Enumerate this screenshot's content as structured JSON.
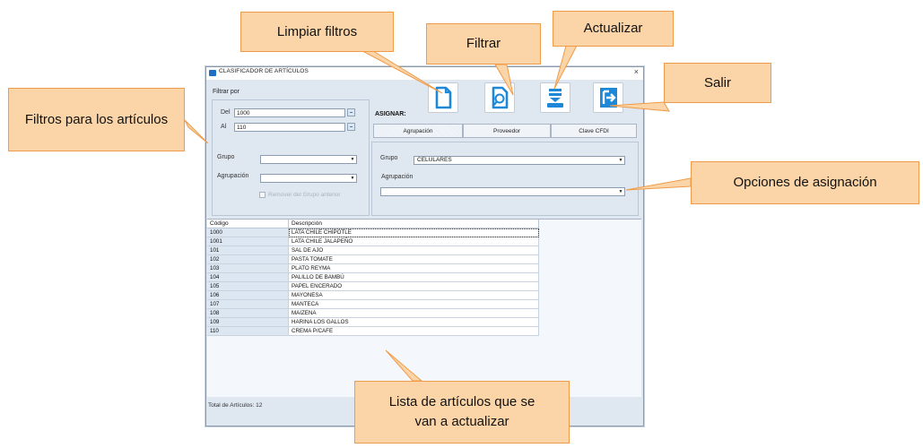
{
  "window": {
    "title": "CLASIFICADOR DE ARTÍCULOS",
    "close_glyph": "×"
  },
  "filters": {
    "title": "Filtrar por",
    "del_label": "Del",
    "del_value": "1000",
    "al_label": "Al",
    "al_value": "110",
    "grupo_label": "Grupo",
    "grupo_value": "",
    "agrupacion_label": "Agrupación",
    "agrupacion_value": "",
    "checkbox_label": "Remover del Grupo anterior"
  },
  "toolbar": {
    "buttons": [
      {
        "name": "limpiar-filtros",
        "icon": "document-icon"
      },
      {
        "name": "filtrar",
        "icon": "magnify-document-icon"
      },
      {
        "name": "actualizar",
        "icon": "download-tray-icon"
      },
      {
        "name": "salir",
        "icon": "exit-door-icon"
      }
    ]
  },
  "assign": {
    "label": "ASIGNAR:",
    "tabs": [
      "Agrupación",
      "Proveedor",
      "Clave CFDI"
    ],
    "active_tab": "Agrupación",
    "grupo_label": "Grupo",
    "grupo_value": "CELULARES",
    "agrupacion_label": "Agrupación",
    "agrupacion_value": ""
  },
  "grid": {
    "columns": [
      "Código",
      "Descripción"
    ],
    "rows": [
      [
        "1000",
        "LATA CHILE CHIPOTLE"
      ],
      [
        "1001",
        "LATA CHILE JALAPEÑO"
      ],
      [
        "101",
        "SAL DE AJO"
      ],
      [
        "102",
        "PASTA TOMATE"
      ],
      [
        "103",
        "PLATO REYMA"
      ],
      [
        "104",
        "PALILLO DE BAMBÚ"
      ],
      [
        "105",
        "PAPEL ENCERADO"
      ],
      [
        "106",
        "MAYONESA"
      ],
      [
        "107",
        "MANTECA"
      ],
      [
        "108",
        "MAIZENA"
      ],
      [
        "109",
        "HARINA LOS GALLOS"
      ],
      [
        "110",
        "CREMA P/CAFE"
      ]
    ]
  },
  "status": {
    "total_label": "Total de Artículos:",
    "total_value": "12"
  },
  "callouts": {
    "limpiar": "Limpiar filtros",
    "filtrar": "Filtrar",
    "actualizar": "Actualizar",
    "salir": "Salir",
    "filtros": "Filtros para los artículos",
    "opciones": "Opciones de asignación",
    "lista": "Lista de artículos que se van a actualizar"
  },
  "colors": {
    "callout_fill": "#fbd5a8",
    "callout_border": "#ef9b49",
    "accent_blue": "#1e88d8"
  }
}
